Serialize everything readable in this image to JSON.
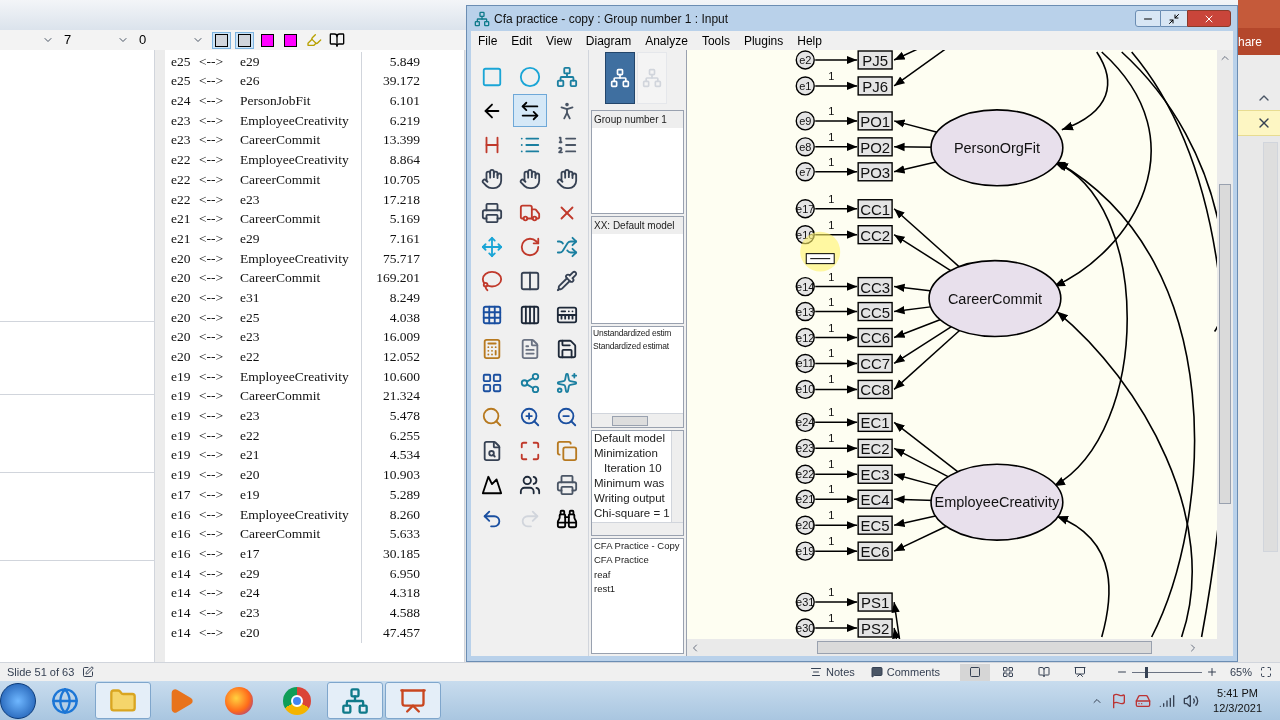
{
  "ppt": {
    "dropdowns": [
      "7",
      "0"
    ],
    "toolbar_buttons": [
      {
        "selected": true
      },
      {
        "selected": true
      },
      {
        "selected": false
      },
      {
        "selected": false
      },
      {
        "selected": false
      },
      {
        "selected": false
      }
    ],
    "table_rows": [
      {
        "from": "e25",
        "link": "<-->",
        "to": "e29",
        "value": "5.849"
      },
      {
        "from": "e25",
        "link": "<-->",
        "to": "e26",
        "value": "39.172"
      },
      {
        "from": "e24",
        "link": "<-->",
        "to": "PersonJobFit",
        "value": "6.101"
      },
      {
        "from": "e23",
        "link": "<-->",
        "to": "EmployeeCreativity",
        "value": "6.219"
      },
      {
        "from": "e23",
        "link": "<-->",
        "to": "CareerCommit",
        "value": "13.399"
      },
      {
        "from": "e22",
        "link": "<-->",
        "to": "EmployeeCreativity",
        "value": "8.864"
      },
      {
        "from": "e22",
        "link": "<-->",
        "to": "CareerCommit",
        "value": "10.705"
      },
      {
        "from": "e22",
        "link": "<-->",
        "to": "e23",
        "value": "17.218"
      },
      {
        "from": "e21",
        "link": "<-->",
        "to": "CareerCommit",
        "value": "5.169"
      },
      {
        "from": "e21",
        "link": "<-->",
        "to": "e29",
        "value": "7.161"
      },
      {
        "from": "e20",
        "link": "<-->",
        "to": "EmployeeCreativity",
        "value": "75.717"
      },
      {
        "from": "e20",
        "link": "<-->",
        "to": "CareerCommit",
        "value": "169.201"
      },
      {
        "from": "e20",
        "link": "<-->",
        "to": "e31",
        "value": "8.249"
      },
      {
        "from": "e20",
        "link": "<-->",
        "to": "e25",
        "value": "4.038"
      },
      {
        "from": "e20",
        "link": "<-->",
        "to": "e23",
        "value": "16.009"
      },
      {
        "from": "e20",
        "link": "<-->",
        "to": "e22",
        "value": "12.052"
      },
      {
        "from": "e19",
        "link": "<-->",
        "to": "EmployeeCreativity",
        "value": "10.600"
      },
      {
        "from": "e19",
        "link": "<-->",
        "to": "CareerCommit",
        "value": "21.324"
      },
      {
        "from": "e19",
        "link": "<-->",
        "to": "e23",
        "value": "5.478"
      },
      {
        "from": "e19",
        "link": "<-->",
        "to": "e22",
        "value": "6.255"
      },
      {
        "from": "e19",
        "link": "<-->",
        "to": "e21",
        "value": "4.534"
      },
      {
        "from": "e19",
        "link": "<-->",
        "to": "e20",
        "value": "10.903"
      },
      {
        "from": "e17",
        "link": "<-->",
        "to": "e19",
        "value": "5.289"
      },
      {
        "from": "e16",
        "link": "<-->",
        "to": "EmployeeCreativity",
        "value": "8.260"
      },
      {
        "from": "e16",
        "link": "<-->",
        "to": "CareerCommit",
        "value": "5.633"
      },
      {
        "from": "e16",
        "link": "<-->",
        "to": "e17",
        "value": "30.185"
      },
      {
        "from": "e14",
        "link": "<-->",
        "to": "e29",
        "value": "6.950"
      },
      {
        "from": "e14",
        "link": "<-->",
        "to": "e24",
        "value": "4.318"
      },
      {
        "from": "e14",
        "link": "<-->",
        "to": "e23",
        "value": "4.588"
      },
      {
        "from": "e14",
        "link": "<-->",
        "to": "e20",
        "value": "47.457"
      }
    ],
    "ribbon_button_partial": "hare",
    "status": {
      "slide": "Slide 51 of 63",
      "notes": "Notes",
      "comments": "Comments",
      "zoom": "65%",
      "zoom_slider": {
        "level": 0.2
      }
    }
  },
  "amos": {
    "title": "Cfa practice - copy : Group number 1 : Input",
    "menu": [
      "File",
      "Edit",
      "View",
      "Diagram",
      "Analyze",
      "Tools",
      "Plugins",
      "Help"
    ],
    "tools": [
      {
        "selected": false
      },
      {
        "selected": false
      },
      {
        "selected": false
      },
      {
        "selected": false
      },
      {
        "selected": true
      },
      {
        "selected": false
      },
      {
        "selected": false
      },
      {
        "selected": false
      },
      {
        "selected": false
      },
      {
        "selected": false
      },
      {
        "selected": false
      },
      {
        "selected": false
      },
      {
        "selected": false
      },
      {
        "selected": false
      },
      {
        "selected": false
      },
      {
        "selected": false
      },
      {
        "selected": false
      },
      {
        "selected": false
      },
      {
        "selected": false
      },
      {
        "selected": false
      },
      {
        "selected": false
      },
      {
        "selected": false
      },
      {
        "selected": false
      },
      {
        "selected": false
      },
      {
        "selected": false
      },
      {
        "selected": false
      },
      {
        "selected": false
      },
      {
        "selected": false
      },
      {
        "selected": false
      },
      {
        "selected": false
      },
      {
        "selected": false
      },
      {
        "selected": false
      },
      {
        "selected": false
      },
      {
        "selected": false
      },
      {
        "selected": false
      },
      {
        "selected": false
      },
      {
        "selected": false
      },
      {
        "selected": false
      },
      {
        "selected": false
      },
      {
        "selected": false
      },
      {
        "selected": false
      },
      {
        "selected": false
      }
    ],
    "view_buttons": [
      {
        "selected": true
      },
      {
        "selected": false
      }
    ],
    "groups": [
      "Group number 1"
    ],
    "models": [
      "XX: Default model"
    ],
    "estimates": [
      "Unstandardized estim",
      "Standardized estimat"
    ],
    "log": [
      {
        "text": "Default model",
        "indented": false
      },
      {
        "text": "Minimization",
        "indented": false
      },
      {
        "text": "Iteration 10",
        "indented": true
      },
      {
        "text": "Minimum was",
        "indented": false
      },
      {
        "text": "Writing output",
        "indented": false
      },
      {
        "text": "Chi-square = 1",
        "indented": false
      }
    ],
    "files": [
      "CFA Practice - Copy",
      "CFA Practice",
      "reaf",
      "rest1"
    ],
    "diagram": {
      "groups": [
        {
          "indicators": [
            {
              "name": "PJ5",
              "error": "e2"
            },
            {
              "name": "PJ6",
              "error": "e1",
              "weight": "1"
            }
          ]
        },
        {
          "latent": "PersonOrgFit",
          "indicators": [
            {
              "name": "PO1",
              "error": "e9",
              "weight": "1"
            },
            {
              "name": "PO2",
              "error": "e8",
              "weight": "1"
            },
            {
              "name": "PO3",
              "error": "e7",
              "weight": "1"
            }
          ]
        },
        {
          "latent": "CareerCommit",
          "indicators": [
            {
              "name": "CC1",
              "error": "e17",
              "weight": "1"
            },
            {
              "name": "CC2",
              "error": "e16",
              "weight": "1"
            },
            {
              "name": "CC3",
              "error": "e14",
              "weight": "1"
            },
            {
              "name": "CC5",
              "error": "e13",
              "weight": "1"
            },
            {
              "name": "CC6",
              "error": "e12",
              "weight": "1"
            },
            {
              "name": "CC7",
              "error": "e11",
              "weight": "1"
            },
            {
              "name": "CC8",
              "error": "e10",
              "weight": "1"
            }
          ]
        },
        {
          "latent": "EmployeeCreativity",
          "indicators": [
            {
              "name": "EC1",
              "error": "e24",
              "weight": "1"
            },
            {
              "name": "EC2",
              "error": "e23",
              "weight": "1"
            },
            {
              "name": "EC3",
              "error": "e22",
              "weight": "1"
            },
            {
              "name": "EC4",
              "error": "e21",
              "weight": "1"
            },
            {
              "name": "EC5",
              "error": "e20",
              "weight": "1"
            },
            {
              "name": "EC6",
              "error": "e19",
              "weight": "1"
            }
          ]
        },
        {
          "indicators": [
            {
              "name": "PS1",
              "error": "e31",
              "weight": "1"
            },
            {
              "name": "PS2",
              "error": "e30",
              "weight": "1"
            }
          ]
        }
      ]
    }
  },
  "taskbar": {
    "apps": [
      {
        "kind": "start",
        "selected": false
      },
      {
        "kind": "browser-ie",
        "selected": false
      },
      {
        "kind": "folder",
        "selected": true
      },
      {
        "kind": "media",
        "selected": false
      },
      {
        "kind": "firefox",
        "selected": false
      },
      {
        "kind": "chrome",
        "selected": false
      },
      {
        "kind": "amos",
        "selected": true
      },
      {
        "kind": "powerpoint",
        "selected": true
      }
    ],
    "time": "5:41 PM",
    "date": "12/3/2021"
  }
}
